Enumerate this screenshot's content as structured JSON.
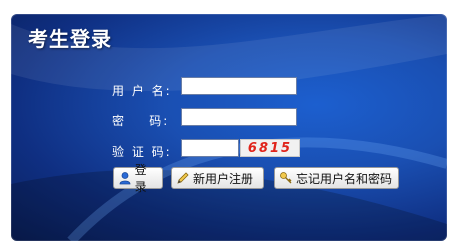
{
  "title": "考生登录",
  "form": {
    "username_label": "用 户 名:",
    "password_label": "密    码:",
    "captcha_label": "验 证 码:",
    "captcha_value": "6815",
    "username_value": "",
    "password_value": "",
    "captcha_input_value": ""
  },
  "buttons": {
    "login": "登录",
    "register": "新用户注册",
    "forgot": "忘记用户名和密码"
  },
  "colors": {
    "panel_blue": "#1a4fb2",
    "captcha_red": "#e0241b"
  },
  "icons": {
    "login": "user-icon",
    "register": "pencil-icon",
    "forgot": "key-icon"
  }
}
